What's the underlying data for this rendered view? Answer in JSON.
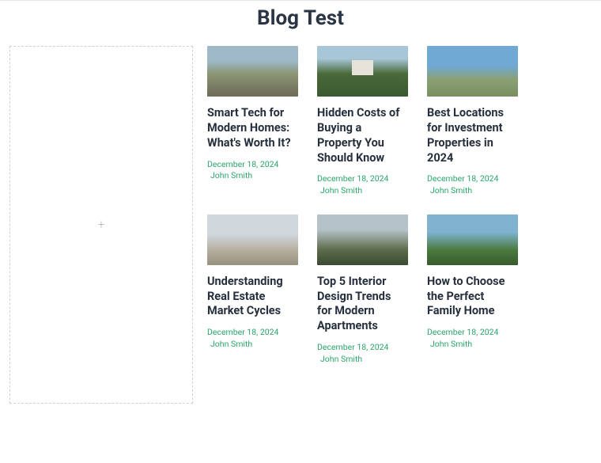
{
  "page": {
    "title": "Blog Test"
  },
  "placeholder": {
    "icon_label": "+"
  },
  "posts": [
    {
      "title": "Smart Tech for Modern Homes: What's Worth It?",
      "date": "December 18, 2024",
      "author": "John Smith",
      "thumb": "t1"
    },
    {
      "title": "Hidden Costs of Buying a Property You Should Know",
      "date": "December 18, 2024",
      "author": "John Smith",
      "thumb": "t2"
    },
    {
      "title": "Best Locations for Investment Properties in 2024",
      "date": "December 18, 2024",
      "author": "John Smith",
      "thumb": "t3"
    },
    {
      "title": "Understanding Real Estate Market Cycles",
      "date": "December 18, 2024",
      "author": "John Smith",
      "thumb": "t4"
    },
    {
      "title": "Top 5 Interior Design Trends for Modern Apartments",
      "date": "December 18, 2024",
      "author": "John Smith",
      "thumb": "t5"
    },
    {
      "title": "How to Choose the Perfect Family Home",
      "date": "December 18, 2024",
      "author": "John Smith",
      "thumb": "t6"
    }
  ]
}
